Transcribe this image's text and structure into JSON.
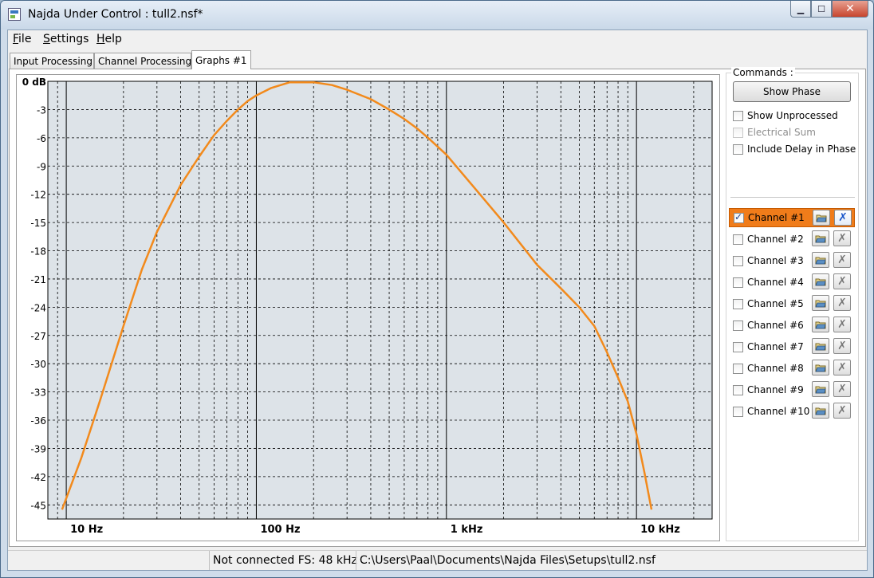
{
  "window": {
    "title": "Najda Under Control : tull2.nsf*",
    "minimize": "▁",
    "maximize": "☐",
    "close": "✕"
  },
  "menu": {
    "file": {
      "accel": "F",
      "rest": "ile"
    },
    "settings": {
      "accel": "S",
      "rest": "ettings"
    },
    "help": {
      "accel": "H",
      "rest": "elp"
    }
  },
  "tabs": [
    "Input Processing",
    "Channel Processing",
    "Graphs #1"
  ],
  "active_tab": "Graphs #1",
  "commands": {
    "title": "Commands :",
    "show_phase": "Show Phase",
    "show_unprocessed": "Show Unprocessed",
    "electrical_sum": "Electrical Sum",
    "include_delay": "Include Delay in Phase"
  },
  "channels": [
    {
      "label": "Channel #1",
      "checked": true,
      "selected": true
    },
    {
      "label": "Channel #2",
      "checked": false,
      "selected": false
    },
    {
      "label": "Channel #3",
      "checked": false,
      "selected": false
    },
    {
      "label": "Channel #4",
      "checked": false,
      "selected": false
    },
    {
      "label": "Channel #5",
      "checked": false,
      "selected": false
    },
    {
      "label": "Channel #6",
      "checked": false,
      "selected": false
    },
    {
      "label": "Channel #7",
      "checked": false,
      "selected": false
    },
    {
      "label": "Channel #8",
      "checked": false,
      "selected": false
    },
    {
      "label": "Channel #9",
      "checked": false,
      "selected": false
    },
    {
      "label": "Channel #10",
      "checked": false,
      "selected": false
    }
  ],
  "channel_icons": {
    "load": "folder-icon",
    "delete": "x-icon"
  },
  "colors": {
    "curve": "#f28a1c",
    "plot_bg": "#dde3e8",
    "selected_channel": "#f07c1a"
  },
  "chart_data": {
    "type": "line",
    "x_scale": "log",
    "xlim": [
      8,
      25000
    ],
    "ylim": [
      -46.5,
      0
    ],
    "x_ticks": [
      {
        "value": 10,
        "label": "10 Hz"
      },
      {
        "value": 100,
        "label": "100 Hz"
      },
      {
        "value": 1000,
        "label": "1 kHz"
      },
      {
        "value": 10000,
        "label": "10 kHz"
      }
    ],
    "y_ticks": [
      {
        "value": 0,
        "label": "0 dB"
      },
      {
        "value": -3,
        "label": "-3"
      },
      {
        "value": -6,
        "label": "-6"
      },
      {
        "value": -9,
        "label": "-9"
      },
      {
        "value": -12,
        "label": "-12"
      },
      {
        "value": -15,
        "label": "-15"
      },
      {
        "value": -18,
        "label": "-18"
      },
      {
        "value": -21,
        "label": "-21"
      },
      {
        "value": -24,
        "label": "-24"
      },
      {
        "value": -27,
        "label": "-27"
      },
      {
        "value": -30,
        "label": "-30"
      },
      {
        "value": -33,
        "label": "-33"
      },
      {
        "value": -36,
        "label": "-36"
      },
      {
        "value": -39,
        "label": "-39"
      },
      {
        "value": -42,
        "label": "-42"
      },
      {
        "value": -45,
        "label": "-45"
      }
    ],
    "grid": true,
    "series": [
      {
        "x": [
          9.5,
          12,
          15,
          20,
          25,
          30,
          40,
          50,
          60,
          70,
          80,
          90,
          100,
          120,
          150,
          200,
          250,
          300,
          400,
          500,
          600,
          700,
          800,
          1000,
          1500,
          2000,
          3000,
          4000,
          5000,
          6000,
          7000,
          8000,
          9000,
          10000,
          11000,
          12000
        ],
        "y": [
          -45.5,
          -40,
          -34,
          -26,
          -20,
          -16,
          -11,
          -8,
          -5.7,
          -4.2,
          -3.0,
          -2.1,
          -1.5,
          -0.7,
          -0.1,
          -0.1,
          -0.4,
          -0.9,
          -1.9,
          -3.0,
          -4.0,
          -5.0,
          -6.0,
          -7.8,
          -12.0,
          -15.0,
          -19.5,
          -22.0,
          -24.0,
          -26.0,
          -28.8,
          -31.5,
          -34.0,
          -37.5,
          -41.5,
          -45.5
        ]
      }
    ]
  },
  "status": {
    "connection": "Not connected FS: 48 kHz",
    "path": "C:\\Users\\Paal\\Documents\\Najda Files\\Setups\\tull2.nsf"
  }
}
